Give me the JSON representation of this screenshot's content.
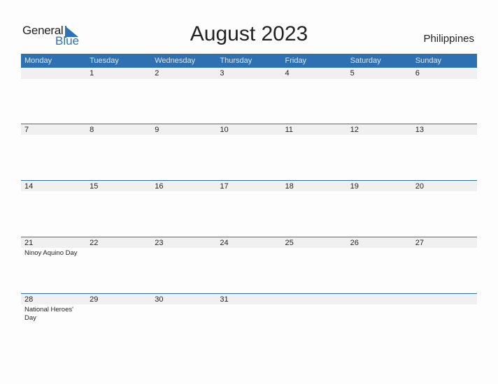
{
  "logo": {
    "line1": "General",
    "line2": "Blue"
  },
  "title": "August 2023",
  "country": "Philippines",
  "colors": {
    "accent": "#2e70b1",
    "band": "#f0f0f0"
  },
  "weekdays": [
    "Monday",
    "Tuesday",
    "Wednesday",
    "Thursday",
    "Friday",
    "Saturday",
    "Sunday"
  ],
  "weeks": [
    [
      {
        "day": ""
      },
      {
        "day": "1"
      },
      {
        "day": "2"
      },
      {
        "day": "3"
      },
      {
        "day": "4"
      },
      {
        "day": "5"
      },
      {
        "day": "6"
      }
    ],
    [
      {
        "day": "7"
      },
      {
        "day": "8"
      },
      {
        "day": "9"
      },
      {
        "day": "10"
      },
      {
        "day": "11"
      },
      {
        "day": "12"
      },
      {
        "day": "13"
      }
    ],
    [
      {
        "day": "14"
      },
      {
        "day": "15"
      },
      {
        "day": "16"
      },
      {
        "day": "17"
      },
      {
        "day": "18"
      },
      {
        "day": "19"
      },
      {
        "day": "20"
      }
    ],
    [
      {
        "day": "21",
        "event": "Ninoy Aquino Day"
      },
      {
        "day": "22"
      },
      {
        "day": "23"
      },
      {
        "day": "24"
      },
      {
        "day": "25"
      },
      {
        "day": "26"
      },
      {
        "day": "27"
      }
    ],
    [
      {
        "day": "28",
        "event": "National Heroes' Day"
      },
      {
        "day": "29"
      },
      {
        "day": "30"
      },
      {
        "day": "31"
      },
      {
        "day": ""
      },
      {
        "day": ""
      },
      {
        "day": ""
      }
    ]
  ]
}
